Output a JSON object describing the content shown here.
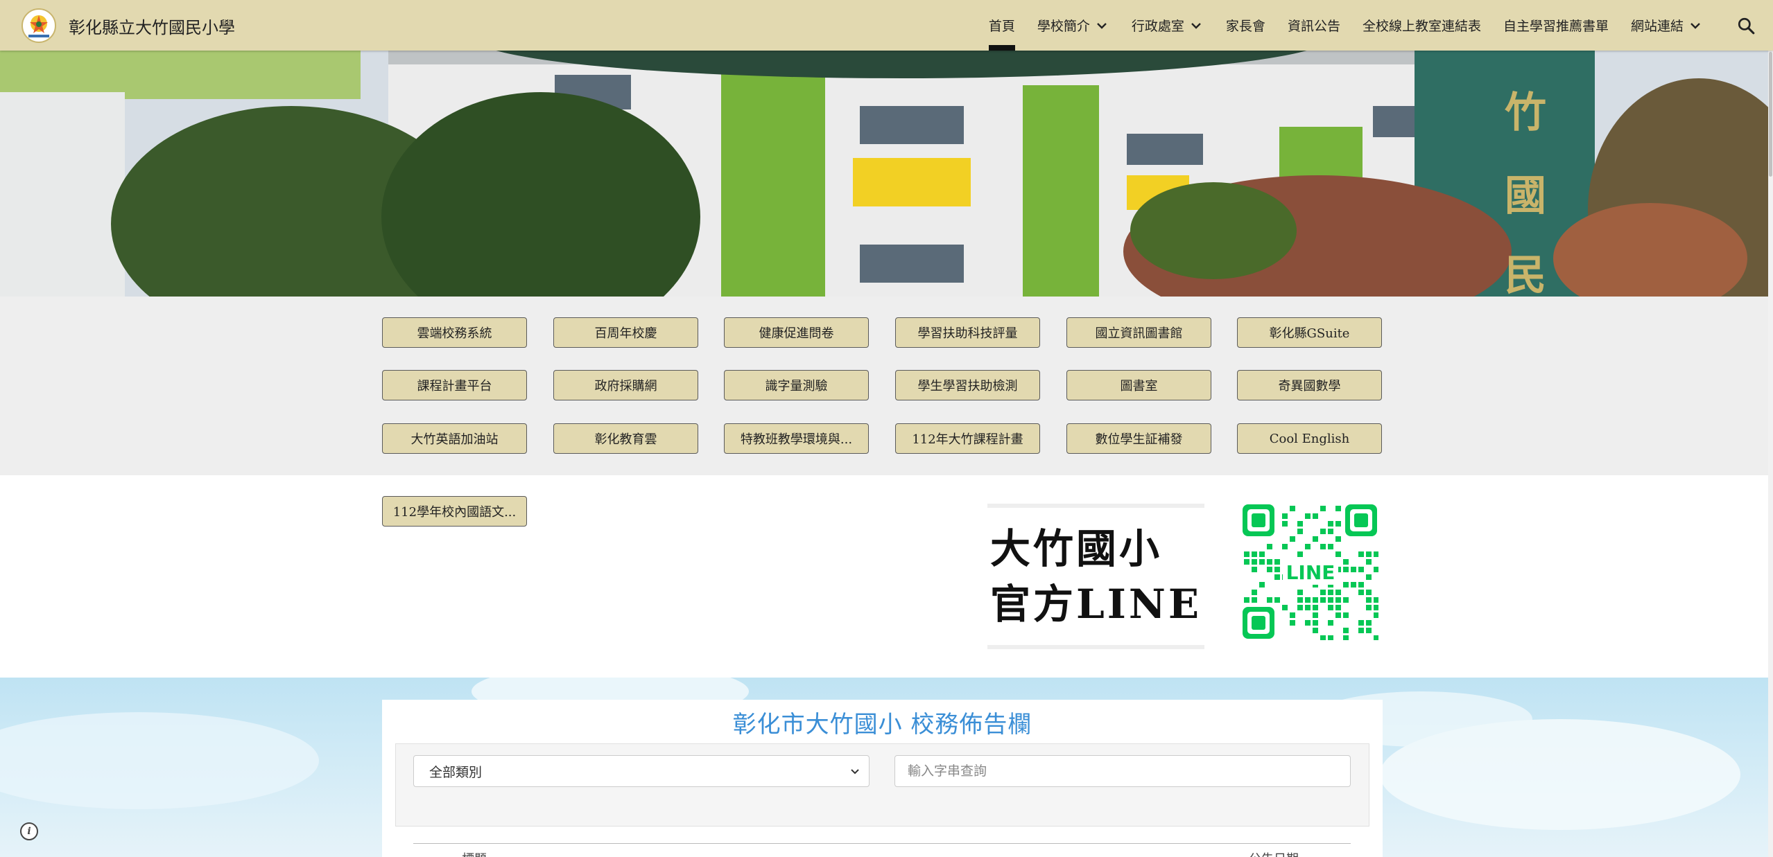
{
  "header": {
    "site_title": "彰化縣立大竹國民小學",
    "logo_icon": "school-emblem-icon",
    "nav": [
      {
        "label": "首頁",
        "active": true,
        "dropdown": false
      },
      {
        "label": "學校簡介",
        "active": false,
        "dropdown": true
      },
      {
        "label": "行政處室",
        "active": false,
        "dropdown": true
      },
      {
        "label": "家長會",
        "active": false,
        "dropdown": false
      },
      {
        "label": "資訊公告",
        "active": false,
        "dropdown": false
      },
      {
        "label": "全校線上教室連結表",
        "active": false,
        "dropdown": false
      },
      {
        "label": "自主學習推薦書單",
        "active": false,
        "dropdown": false
      },
      {
        "label": "網站連結",
        "active": false,
        "dropdown": true
      }
    ],
    "search_icon": "search-icon"
  },
  "quick_links": {
    "row1": [
      "雲端校務系統",
      "百周年校慶",
      "健康促進問卷",
      "學習扶助科技評量",
      "國立資訊圖書館",
      "彰化縣GSuite"
    ],
    "row2": [
      "課程計畫平台",
      "政府採購網",
      "識字量測驗",
      "學生學習扶助檢測",
      "圖書室",
      "奇異國數學"
    ],
    "row3": [
      "大竹英語加油站",
      "彰化教育雲",
      "特教班教學環境與...",
      "112年大竹課程計畫",
      "數位學生証補發",
      "Cool English"
    ],
    "extra": "112學年校內國語文..."
  },
  "line_promo": {
    "line1": "大竹國小",
    "line2": "官方LINE",
    "qr_label": "LINE"
  },
  "bulletin": {
    "title": "彰化市大竹國小 校務佈告欄",
    "category_select": "全部類別",
    "search_placeholder": "輸入字串查詢",
    "col_title": "標題",
    "col_date": "公告日期"
  },
  "colors": {
    "header_bg": "#e2d9b0",
    "button_bg": "#e2d9b0",
    "bulletin_title": "#3a8ed6",
    "line_green": "#06c755"
  }
}
